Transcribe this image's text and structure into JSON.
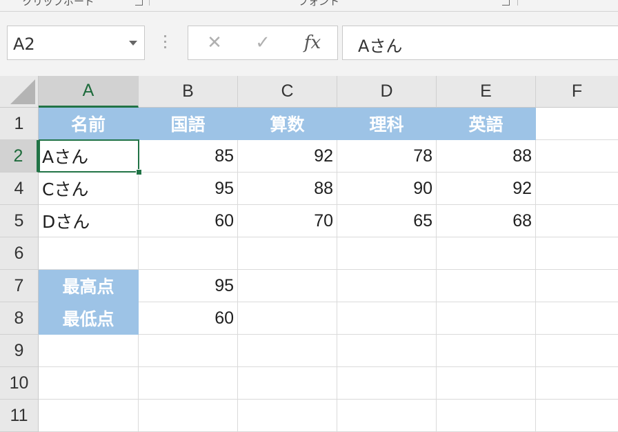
{
  "ribbon": {
    "clipboard_label": "クリップボード",
    "font_label": "フォント"
  },
  "formula_bar": {
    "name_box": "A2",
    "cancel_icon": "✕",
    "enter_icon": "✓",
    "fx_label": "fx",
    "content": "Aさん"
  },
  "columns": [
    "A",
    "B",
    "C",
    "D",
    "E",
    "F"
  ],
  "selected_column": "A",
  "rows": [
    {
      "label": "1",
      "cells": [
        "名前",
        "国語",
        "算数",
        "理科",
        "英語",
        ""
      ]
    },
    {
      "label": "2",
      "cells": [
        "Aさん",
        "85",
        "92",
        "78",
        "88",
        ""
      ]
    },
    {
      "label": "4",
      "cells": [
        "Cさん",
        "95",
        "88",
        "90",
        "92",
        ""
      ]
    },
    {
      "label": "5",
      "cells": [
        "Dさん",
        "60",
        "70",
        "65",
        "68",
        ""
      ]
    },
    {
      "label": "6",
      "cells": [
        "",
        "",
        "",
        "",
        "",
        ""
      ]
    },
    {
      "label": "7",
      "cells": [
        "最高点",
        "95",
        "",
        "",
        "",
        ""
      ]
    },
    {
      "label": "8",
      "cells": [
        "最低点",
        "60",
        "",
        "",
        "",
        ""
      ]
    },
    {
      "label": "9",
      "cells": [
        "",
        "",
        "",
        "",
        "",
        ""
      ]
    },
    {
      "label": "10",
      "cells": [
        "",
        "",
        "",
        "",
        "",
        ""
      ]
    },
    {
      "label": "11",
      "cells": [
        "",
        "",
        "",
        "",
        "",
        ""
      ]
    }
  ],
  "selected_cell": "A2",
  "colors": {
    "header_fill": "#9dc3e6",
    "selection": "#217346"
  }
}
